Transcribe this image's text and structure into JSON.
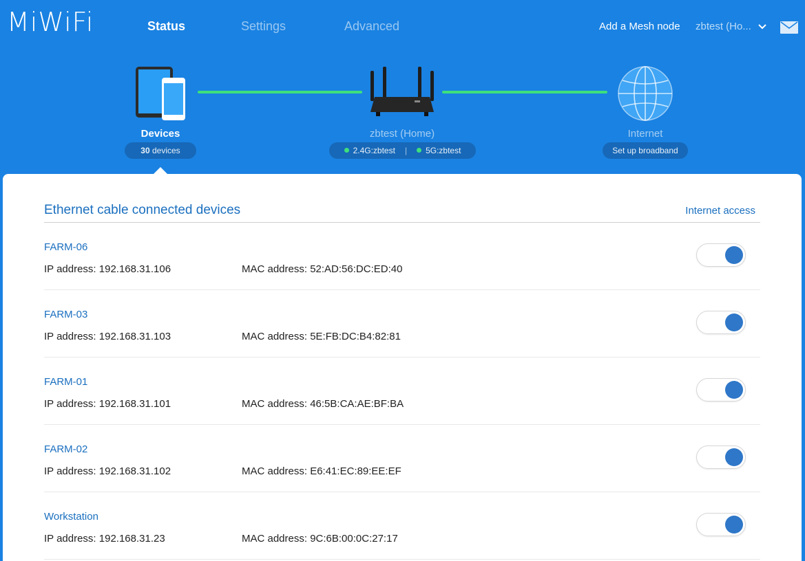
{
  "header": {
    "logo": "MiWiFi",
    "tabs": [
      {
        "label": "Status",
        "active": true
      },
      {
        "label": "Settings",
        "active": false
      },
      {
        "label": "Advanced",
        "active": false
      }
    ],
    "mesh_link": "Add a Mesh node",
    "account": "zbtest (Ho..."
  },
  "topology": {
    "devices": {
      "label": "Devices",
      "count_number": "30",
      "count_suffix": " devices"
    },
    "router": {
      "label": "zbtest (Home)",
      "wifi_24": "2.4G:zbtest",
      "wifi_5": "5G:zbtest"
    },
    "internet": {
      "label": "Internet",
      "status": "Set up broadband"
    }
  },
  "section": {
    "title": "Ethernet cable connected devices",
    "link": "Internet access"
  },
  "devices": [
    {
      "name": "FARM-06",
      "ip": "IP address: 192.168.31.106",
      "mac": "MAC address: 52:AD:56:DC:ED:40",
      "internet_access": true
    },
    {
      "name": "FARM-03",
      "ip": "IP address: 192.168.31.103",
      "mac": "MAC address: 5E:FB:DC:B4:82:81",
      "internet_access": true
    },
    {
      "name": "FARM-01",
      "ip": "IP address: 192.168.31.101",
      "mac": "MAC address: 46:5B:CA:AE:BF:BA",
      "internet_access": true
    },
    {
      "name": "FARM-02",
      "ip": "IP address: 192.168.31.102",
      "mac": "MAC address: E6:41:EC:89:EE:EF",
      "internet_access": true
    },
    {
      "name": "Workstation",
      "ip": "IP address: 192.168.31.23",
      "mac": "MAC address: 9C:6B:00:0C:27:17",
      "internet_access": true
    }
  ],
  "colors": {
    "header_bg": "#1a82e2",
    "link_line": "#3ee07c",
    "accent": "#1a6fbf",
    "toggle_knob": "#2f77c8"
  }
}
